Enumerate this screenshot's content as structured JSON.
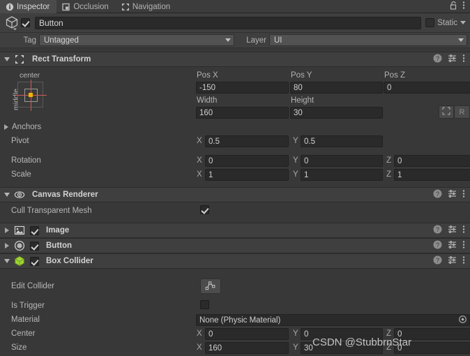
{
  "window": {
    "tabs": [
      {
        "label": "Inspector",
        "icon": "info-icon",
        "active": true
      },
      {
        "label": "Occlusion",
        "icon": "occlusion-icon",
        "active": false
      },
      {
        "label": "Navigation",
        "icon": "navigation-icon",
        "active": false
      }
    ],
    "lock_icon": "lock-open-icon",
    "menu_icon": "kebab-menu-icon"
  },
  "gameobject": {
    "icon": "cube-gameobject-icon",
    "enabled_checkbox": "checked",
    "name": "Button",
    "static_label": "Static",
    "static_checked": false,
    "tag_label": "Tag",
    "tag_value": "Untagged",
    "layer_label": "Layer",
    "layer_value": "UI"
  },
  "components": [
    {
      "id": "rect-transform",
      "title": "Rect Transform",
      "icon": "rect-transform-icon",
      "expanded": true,
      "has_enable_checkbox": false,
      "header_icons": []
    },
    {
      "id": "canvas-renderer",
      "title": "Canvas Renderer",
      "icon": "eye-icon",
      "expanded": true,
      "has_enable_checkbox": false,
      "header_icons": [
        "help-icon",
        "preset-icon",
        "kebab-menu-icon"
      ]
    },
    {
      "id": "image",
      "title": "Image",
      "icon": "image-component-icon",
      "expanded": false,
      "has_enable_checkbox": true,
      "enabled": true,
      "header_icons": [
        "help-icon",
        "preset-icon",
        "kebab-menu-icon"
      ]
    },
    {
      "id": "button",
      "title": "Button",
      "icon": "button-component-icon",
      "expanded": false,
      "has_enable_checkbox": true,
      "enabled": true,
      "header_icons": [
        "help-icon",
        "preset-icon",
        "kebab-menu-icon"
      ]
    },
    {
      "id": "box-collider",
      "title": "Box Collider",
      "icon": "box-collider-icon",
      "expanded": true,
      "has_enable_checkbox": true,
      "enabled": true,
      "header_icons": [
        "help-icon",
        "preset-icon",
        "kebab-menu-icon"
      ]
    }
  ],
  "rect_transform": {
    "anchor_preset": {
      "horizontal_label": "center",
      "vertical_label": "middle"
    },
    "pos_x_label": "Pos X",
    "pos_x_value": "-150",
    "pos_y_label": "Pos Y",
    "pos_y_value": "80",
    "pos_z_label": "Pos Z",
    "pos_z_value": "0",
    "width_label": "Width",
    "width_value": "160",
    "height_label": "Height",
    "height_value": "30",
    "blueprint_button": "blueprint-mode-icon",
    "raw_button": "R",
    "anchors_label": "Anchors",
    "anchors_expanded": false,
    "pivot_label": "Pivot",
    "pivot_x_axis": "X",
    "pivot_x_value": "0.5",
    "pivot_y_axis": "Y",
    "pivot_y_value": "0.5",
    "rotation_label": "Rotation",
    "rotation_x_axis": "X",
    "rotation_x_value": "0",
    "rotation_y_axis": "Y",
    "rotation_y_value": "0",
    "rotation_z_axis": "Z",
    "rotation_z_value": "0",
    "scale_label": "Scale",
    "scale_x_axis": "X",
    "scale_x_value": "1",
    "scale_y_axis": "Y",
    "scale_y_value": "1",
    "scale_z_axis": "Z",
    "scale_z_value": "1"
  },
  "canvas_renderer": {
    "cull_label": "Cull Transparent Mesh",
    "cull_checked": true
  },
  "box_collider": {
    "edit_collider_label": "Edit Collider",
    "edit_collider_icon": "edit-collider-icon",
    "is_trigger_label": "Is Trigger",
    "is_trigger_checked": false,
    "material_label": "Material",
    "material_value": "None (Physic Material)",
    "material_picker_icon": "object-picker-icon",
    "center_label": "Center",
    "center_x_axis": "X",
    "center_x_value": "0",
    "center_y_axis": "Y",
    "center_y_value": "0",
    "center_z_axis": "Z",
    "center_z_value": "0",
    "size_label": "Size",
    "size_x_axis": "X",
    "size_x_value": "160",
    "size_y_axis": "Y",
    "size_y_value": "30",
    "size_z_axis": "Z",
    "size_z_value": "0"
  },
  "watermark": {
    "text": "CSDN @StubbrnStar"
  },
  "colors": {
    "panel_bg": "#383838",
    "header_bg": "#3f3f3f",
    "tab_active": "#4a4a4a",
    "field_bg": "#2a2a2a",
    "dropdown_bg": "#525252",
    "text": "#c4c4c4",
    "anchor_red": "#d05a5a",
    "anchor_dot": "#f0b400",
    "collider_green": "#a0d636"
  }
}
